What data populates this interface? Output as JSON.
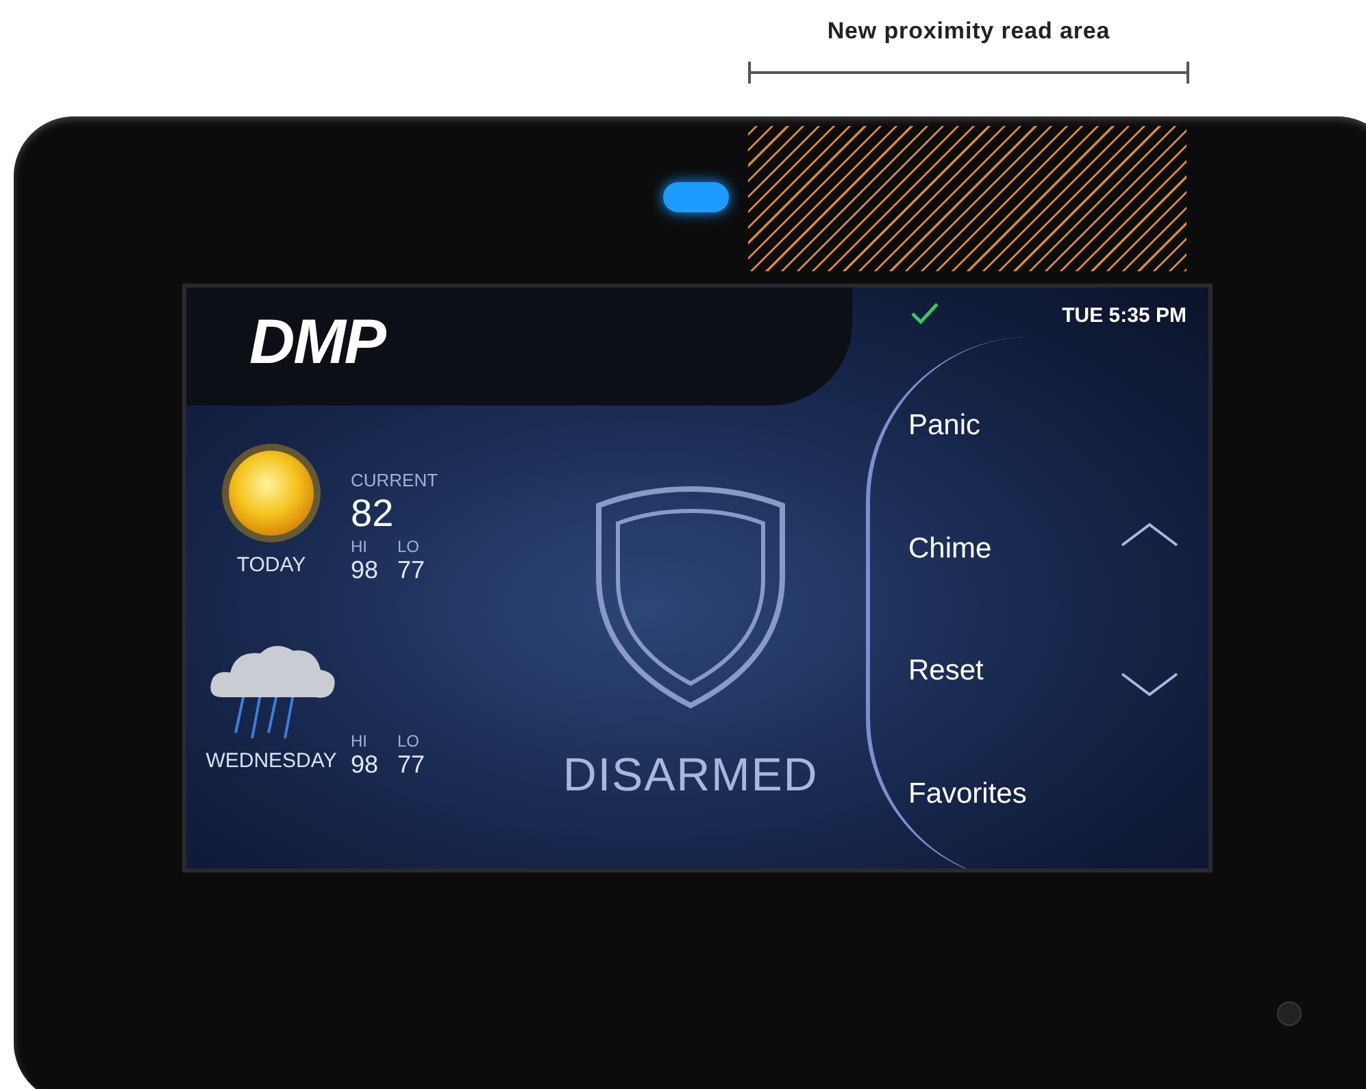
{
  "annotation": {
    "label": "New proximity read area"
  },
  "status": {
    "logo": "DMP",
    "ok": true,
    "time": "TUE 5:35 PM"
  },
  "weather": [
    {
      "kind": "sunny",
      "day": "TODAY",
      "current_label": "CURRENT",
      "current": "82",
      "hi_label": "HI",
      "lo_label": "LO",
      "hi": "98",
      "lo": "77"
    },
    {
      "kind": "rain",
      "day": "WEDNESDAY",
      "hi_label": "HI",
      "lo_label": "LO",
      "hi": "98",
      "lo": "77"
    }
  ],
  "system": {
    "state": "DISARMED"
  },
  "menu": [
    {
      "label": "Panic"
    },
    {
      "label": "Chime"
    },
    {
      "label": "Reset"
    },
    {
      "label": "Favorites"
    }
  ]
}
